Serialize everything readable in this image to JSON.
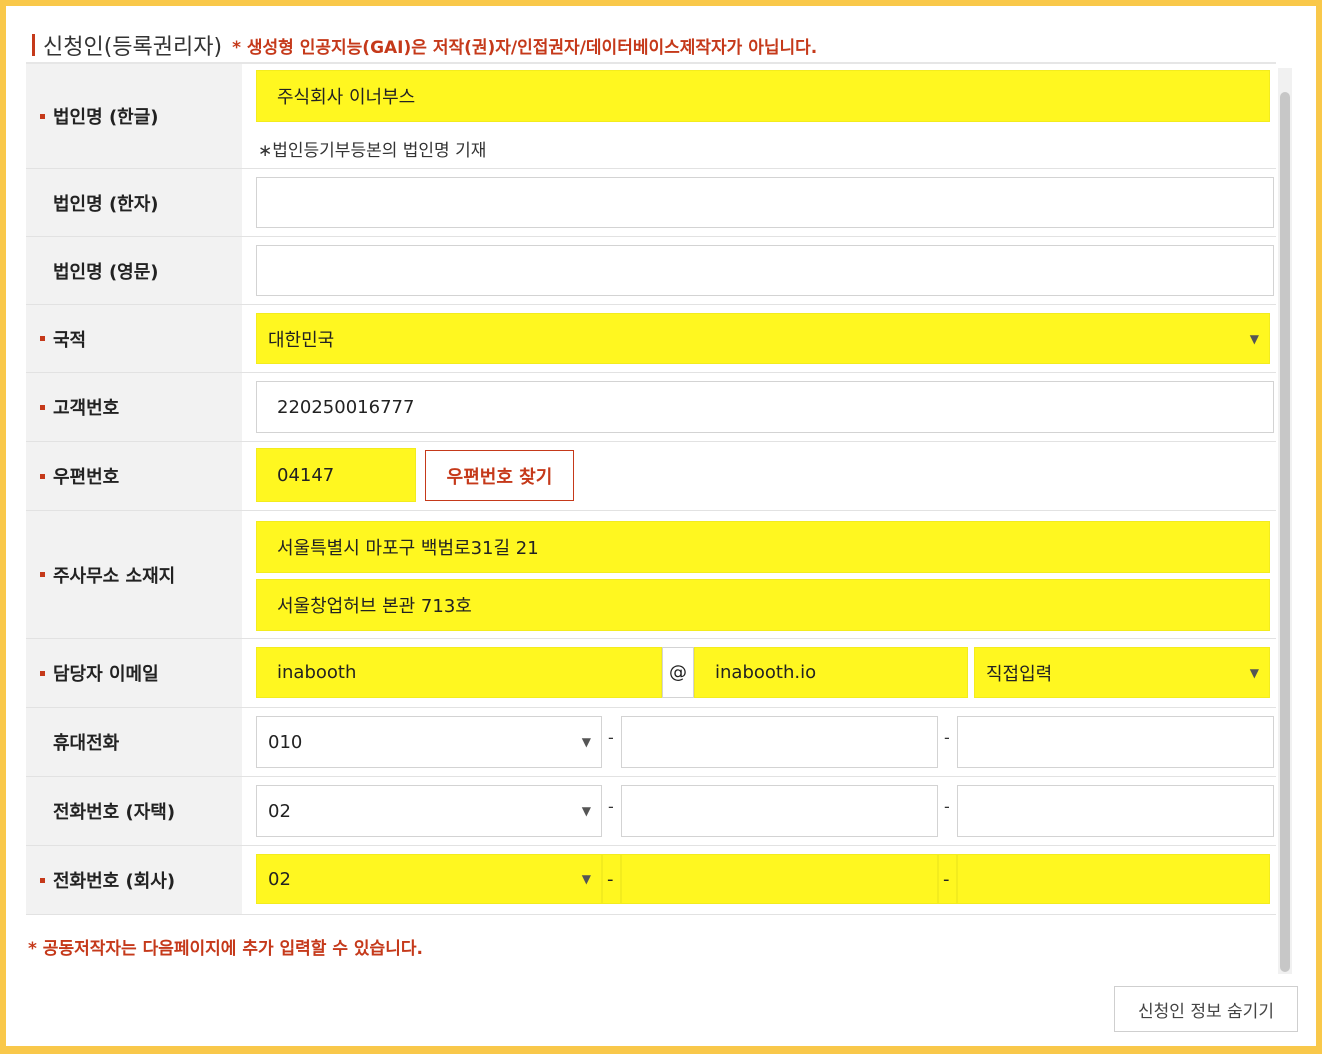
{
  "section": {
    "title": "신청인(등록권리자)",
    "notice": "* 생성형 인공지능(GAI)은 저작(권)자/인접권자/데이터베이스제작자가 아닙니다."
  },
  "fields": {
    "corp_name_kr": {
      "label": "법인명 (한글)",
      "value": "주식회사 이너부스",
      "hint": "∗법인등기부등본의 법인명 기재"
    },
    "corp_name_hanja": {
      "label": "법인명 (한자)",
      "value": ""
    },
    "corp_name_en": {
      "label": "법인명 (영문)",
      "value": ""
    },
    "nationality": {
      "label": "국적",
      "value": "대한민국"
    },
    "customer_no": {
      "label": "고객번호",
      "value": "220250016777"
    },
    "zipcode": {
      "label": "우편번호",
      "value": "04147",
      "button": "우편번호 찾기"
    },
    "address": {
      "label": "주사무소 소재지",
      "line1": "서울특별시 마포구 백범로31길 21",
      "line2": "서울창업허브 본관 713호"
    },
    "email": {
      "label": "담당자 이메일",
      "id": "inabooth",
      "at": "@",
      "domain": "inabooth.io",
      "domain_select": "직접입력"
    },
    "mobile": {
      "label": "휴대전화",
      "prefix": "010",
      "mid": "",
      "last": ""
    },
    "phone_home": {
      "label": "전화번호 (자택)",
      "prefix": "02",
      "mid": "",
      "last": ""
    },
    "phone_office": {
      "label": "전화번호 (회사)",
      "prefix": "02",
      "mid": "",
      "last": ""
    }
  },
  "dash": "-",
  "footnote": "* 공동저작자는 다음페이지에 추가 입력할 수 있습니다.",
  "hide_button": "신청인 정보 숨기기",
  "colors": {
    "highlight": "#fff720",
    "accent": "#c5391a",
    "frame": "#f9c84a"
  }
}
